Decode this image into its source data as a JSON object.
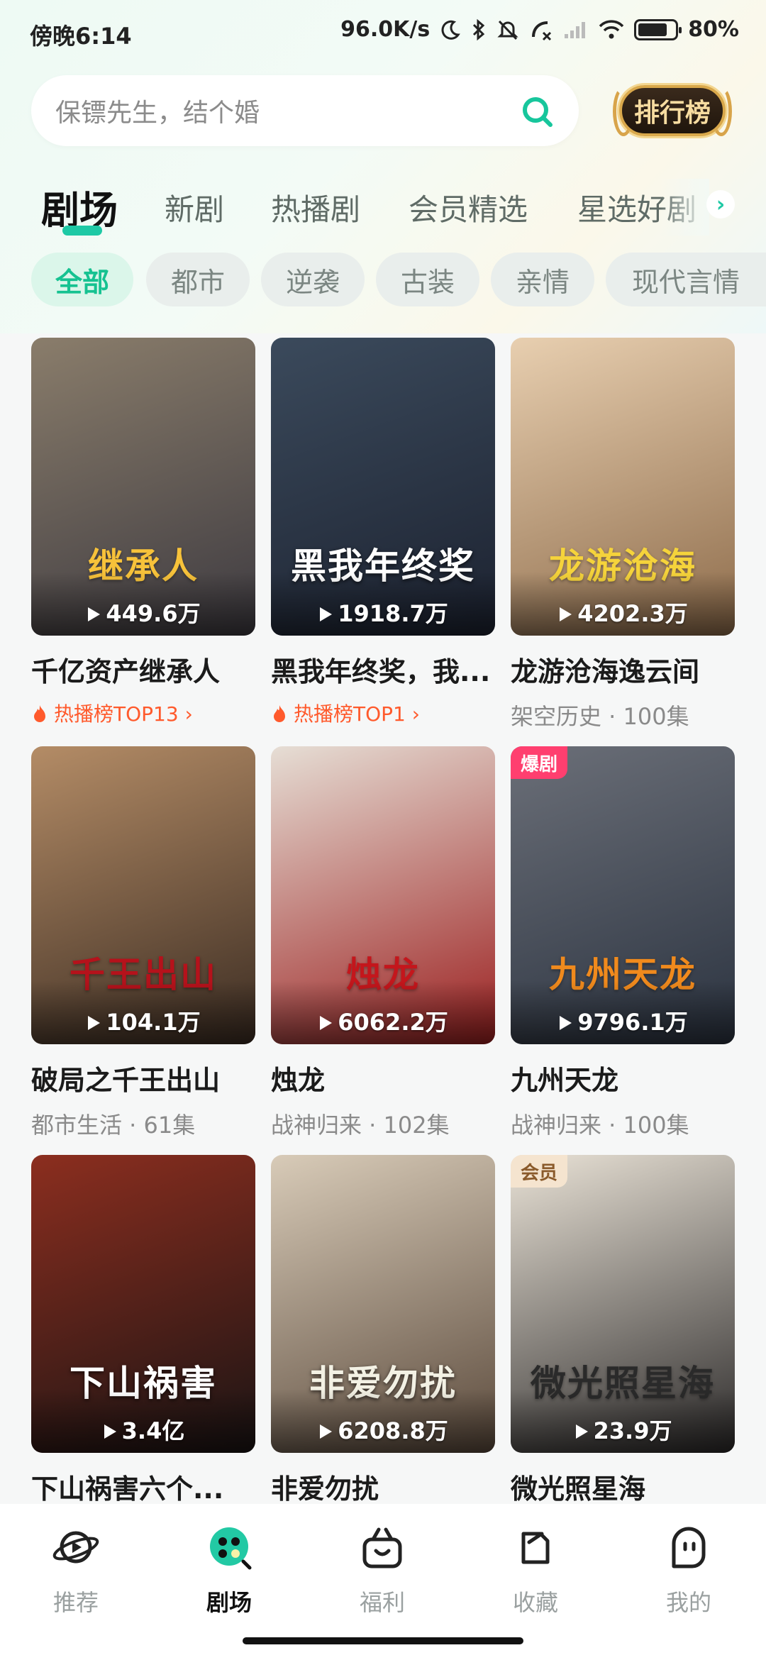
{
  "status_bar": {
    "time": "傍晚6:14",
    "network_speed": "96.0K/s",
    "battery": "80%",
    "battery_level": 0.8
  },
  "search": {
    "placeholder": "保镖先生，结个婚",
    "icon": "search-icon"
  },
  "rank_button": {
    "label": "排行榜"
  },
  "tabs": [
    {
      "label": "剧场",
      "active": true
    },
    {
      "label": "新剧"
    },
    {
      "label": "热播剧"
    },
    {
      "label": "会员精选"
    },
    {
      "label": "星选好剧"
    }
  ],
  "chips": [
    {
      "label": "全部",
      "active": true
    },
    {
      "label": "都市"
    },
    {
      "label": "逆袭"
    },
    {
      "label": "古装"
    },
    {
      "label": "亲情"
    },
    {
      "label": "现代言情"
    }
  ],
  "dramas": [
    {
      "title": "千亿资产继承人",
      "plays": "449.6万",
      "subtitle": "热播榜TOP13",
      "poster_text": "继承人",
      "poster_colors": [
        "#8a7d6b",
        "#3d3a40"
      ],
      "title_color": "#f7c23a"
    },
    {
      "title": "黑我年终奖，我...",
      "plays": "1918.7万",
      "subtitle": "热播榜TOP1",
      "poster_text": "黑我年终奖",
      "poster_colors": [
        "#3b4a5c",
        "#1c2230"
      ],
      "title_color": "#ffffff"
    },
    {
      "title": "龙游沧海逸云间",
      "plays": "4202.3万",
      "meta": "架空历史 · 100集",
      "poster_text": "龙游沧海",
      "poster_colors": [
        "#e8cfb0",
        "#8d6b4a"
      ],
      "title_color": "#f5d33b"
    },
    {
      "title": "破局之千王出山",
      "plays": "104.1万",
      "meta": "都市生活 · 61集",
      "poster_text": "千王出山",
      "poster_colors": [
        "#b48c66",
        "#3b2c22"
      ],
      "title_color": "#b5121b"
    },
    {
      "title": "烛龙",
      "plays": "6062.2万",
      "meta": "战神归来 · 102集",
      "poster_text": "烛龙",
      "poster_colors": [
        "#e6ded5",
        "#9b1f1f"
      ],
      "title_color": "#c4161c"
    },
    {
      "title": "九州天龙",
      "plays": "9796.1万",
      "meta": "战神归来 · 100集",
      "tag": "爆剧",
      "tag_type": "hot",
      "poster_text": "九州天龙",
      "poster_colors": [
        "#6b6f78",
        "#2b3340"
      ],
      "title_color": "#f08a1d"
    },
    {
      "title": "下山祸害六个...",
      "plays": "3.4亿",
      "poster_text": "下山祸害",
      "poster_colors": [
        "#8c2e1f",
        "#1a1414"
      ],
      "title_color": "#ffffff"
    },
    {
      "title": "非爱勿扰",
      "plays": "6208.8万",
      "poster_text": "非爱勿扰",
      "poster_colors": [
        "#d8cbb8",
        "#5b4a3c"
      ],
      "title_color": "#f3f1e4"
    },
    {
      "title": "微光照星海",
      "plays": "23.9万",
      "tag": "会员",
      "tag_type": "vip",
      "poster_text": "微光照星海",
      "poster_colors": [
        "#e9e2d6",
        "#2c2a2a"
      ],
      "title_color": "#2a2a2a"
    }
  ],
  "bottom_nav": [
    {
      "label": "推荐",
      "icon": "planet-play-icon"
    },
    {
      "label": "剧场",
      "icon": "theater-icon",
      "active": true
    },
    {
      "label": "福利",
      "icon": "gift-icon"
    },
    {
      "label": "收藏",
      "icon": "bookmark-icon"
    },
    {
      "label": "我的",
      "icon": "profile-icon"
    }
  ]
}
